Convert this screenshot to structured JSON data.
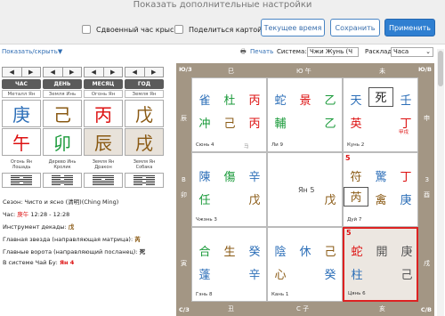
{
  "top": {
    "title": "Показать дополнительные настройки",
    "checkbox_rat": "Сдвоенный час крысы",
    "checkbox_share": "Поделиться картой",
    "btn_current_time": "Текущее время",
    "btn_save": "Сохранить",
    "btn_apply": "Применить"
  },
  "toolbar": {
    "show_hide": "Показать/скрыть",
    "print": "Печать",
    "system_label": "Система:",
    "system_value": "Чжи Жунь (Ч",
    "layout_label": "Расклад:",
    "layout_value": "Часа"
  },
  "pillars": {
    "headers": [
      "ЧАС",
      "ДЕНЬ",
      "МЕСЯЦ",
      "ГОД"
    ],
    "elements": [
      "Металл Ян",
      "Земля Инь",
      "Огонь Ян",
      "Земля Ян"
    ],
    "stems": [
      "庚",
      "己",
      "丙",
      "戊"
    ],
    "branches": [
      "午",
      "卯",
      "辰",
      "戌"
    ],
    "branch_desc": [
      "Огонь Ян Лошадь",
      "Дерево Инь Кролик",
      "Земля Ян Дракон",
      "Земля Ян Собака"
    ]
  },
  "info": {
    "season_label": "Сезон:",
    "season_value": "Чисто и ясно (清明)(Ching Ming)",
    "hour_label": "Час:",
    "hour_branch": "庚午",
    "hour_time": "12:28 - 12:28",
    "decade_label": "Инструмент декады:",
    "decade_value": "戊",
    "star_label": "Главная звезда (направляющая матрица):",
    "star_value": "芮",
    "gate_label": "Главные ворота (направляющий посланец):",
    "gate_value": "死",
    "chaibu_label": "В системе Чай Бу:",
    "chaibu_value": "Ян 4"
  },
  "board": {
    "corners": {
      "tl": "Ю/З",
      "tr": "Ю/В",
      "bl": "С/З",
      "br": "С/В"
    },
    "top_edge": [
      "巳",
      "Ю 午",
      "未"
    ],
    "bottom_edge": [
      "丑",
      "С 子",
      "亥"
    ],
    "left_edge": [
      "辰",
      "В",
      "卯",
      "寅"
    ],
    "right_edge": [
      "申",
      "З",
      "酉",
      "戌"
    ],
    "cells": {
      "nw": {
        "r1": [
          "雀",
          "杜",
          "丙"
        ],
        "r2": [
          "冲",
          "己",
          "丙"
        ],
        "label": "Сюнь 4",
        "extra": "马"
      },
      "n": {
        "r1": [
          "蛇",
          "景",
          "乙"
        ],
        "r2": [
          "輔",
          "",
          "乙"
        ],
        "label": "Ли 9"
      },
      "ne": {
        "r1": [
          "天",
          "死",
          "壬"
        ],
        "r2": [
          "英",
          "",
          "丁"
        ],
        "label": "Кунь 2",
        "note": "甲戌"
      },
      "w": {
        "r1": [
          "陳",
          "傷",
          "辛"
        ],
        "r2": [
          "任",
          "",
          "戊"
        ],
        "label": "Чжэнь 3"
      },
      "c": {
        "text": "Ян 5",
        "stem": "戊"
      },
      "e": {
        "r1": [
          "符",
          "驚",
          "丁"
        ],
        "r2": [
          "芮",
          "禽",
          "庚"
        ],
        "label": "Дуй 7"
      },
      "sw": {
        "r1": [
          "合",
          "生",
          "癸"
        ],
        "r2": [
          "蓬",
          "",
          "辛"
        ],
        "label": "Гэнь 8"
      },
      "s": {
        "r1": [
          "陰",
          "休",
          "己"
        ],
        "r2": [
          "心",
          "",
          "癸"
        ],
        "label": "Кань 1"
      },
      "se": {
        "r1": [
          "蛇",
          "開",
          "庚"
        ],
        "r2": [
          "柱",
          "",
          "己"
        ],
        "label": "Цянь 6"
      }
    }
  },
  "colors": {
    "accent": "#2f7fd1",
    "board": "#a39684",
    "fire": "#d11",
    "wood": "#1a9a3a",
    "metal": "#2d6fb8",
    "highlight": "#d22"
  }
}
